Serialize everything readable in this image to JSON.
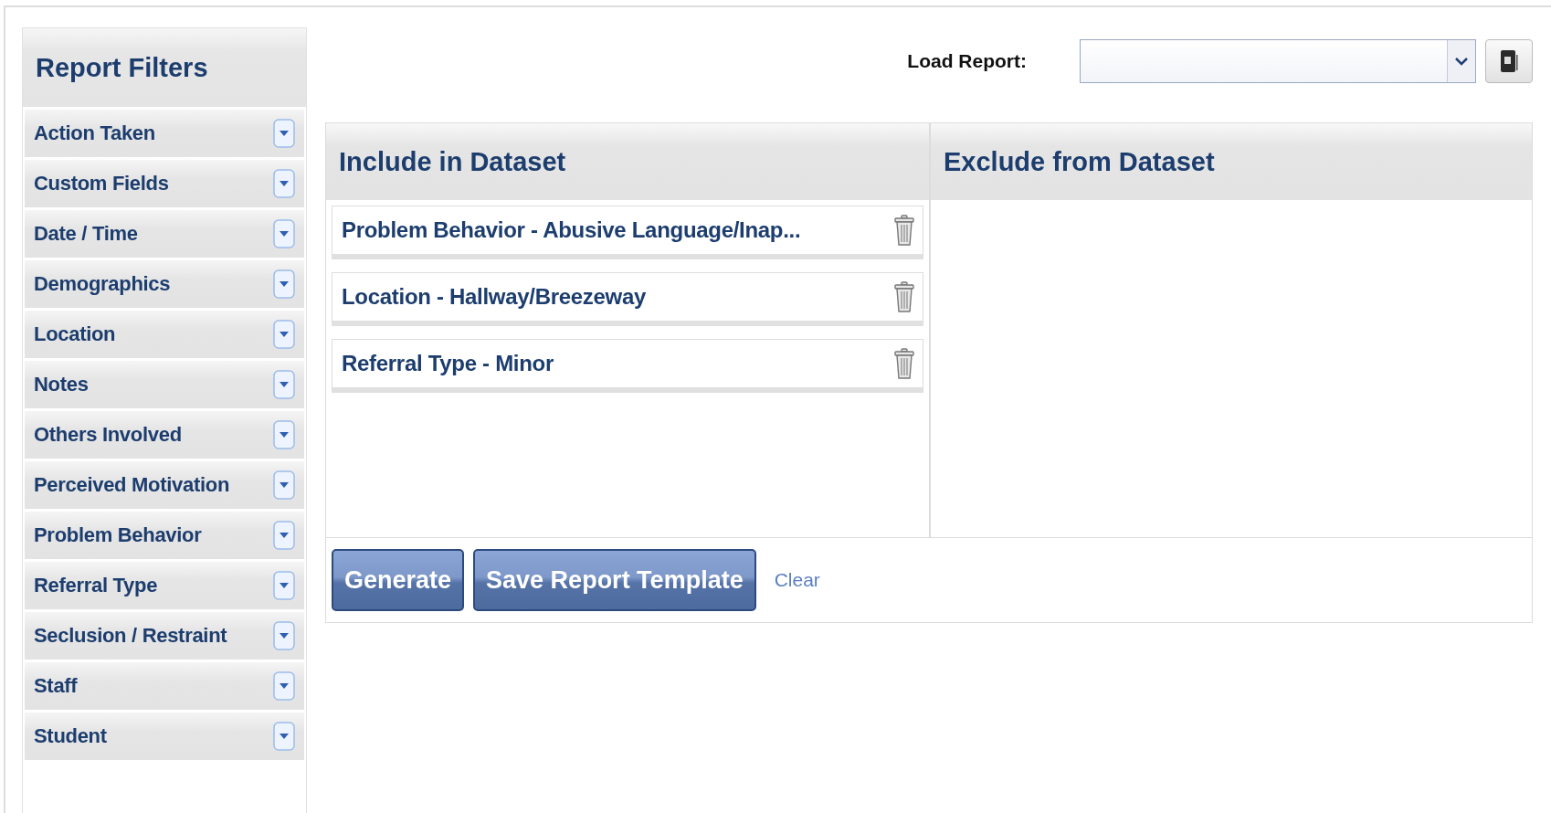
{
  "sidebar": {
    "title": "Report Filters",
    "items": [
      {
        "label": "Action Taken"
      },
      {
        "label": "Custom Fields"
      },
      {
        "label": "Date / Time"
      },
      {
        "label": "Demographics"
      },
      {
        "label": "Location"
      },
      {
        "label": "Notes"
      },
      {
        "label": "Others Involved"
      },
      {
        "label": "Perceived Motivation"
      },
      {
        "label": "Problem Behavior"
      },
      {
        "label": "Referral Type"
      },
      {
        "label": "Seclusion / Restraint"
      },
      {
        "label": "Staff"
      },
      {
        "label": "Student"
      }
    ]
  },
  "load_report": {
    "label": "Load Report:"
  },
  "include": {
    "title": "Include in Dataset",
    "items": [
      {
        "label": "Problem Behavior - Abusive Language/Inap..."
      },
      {
        "label": "Location - Hallway/Breezeway"
      },
      {
        "label": "Referral Type - Minor"
      }
    ]
  },
  "exclude": {
    "title": "Exclude from Dataset"
  },
  "buttons": [
    {
      "label": "Generate"
    },
    {
      "label": "Save Report Template"
    }
  ],
  "clear_link": "Clear"
}
